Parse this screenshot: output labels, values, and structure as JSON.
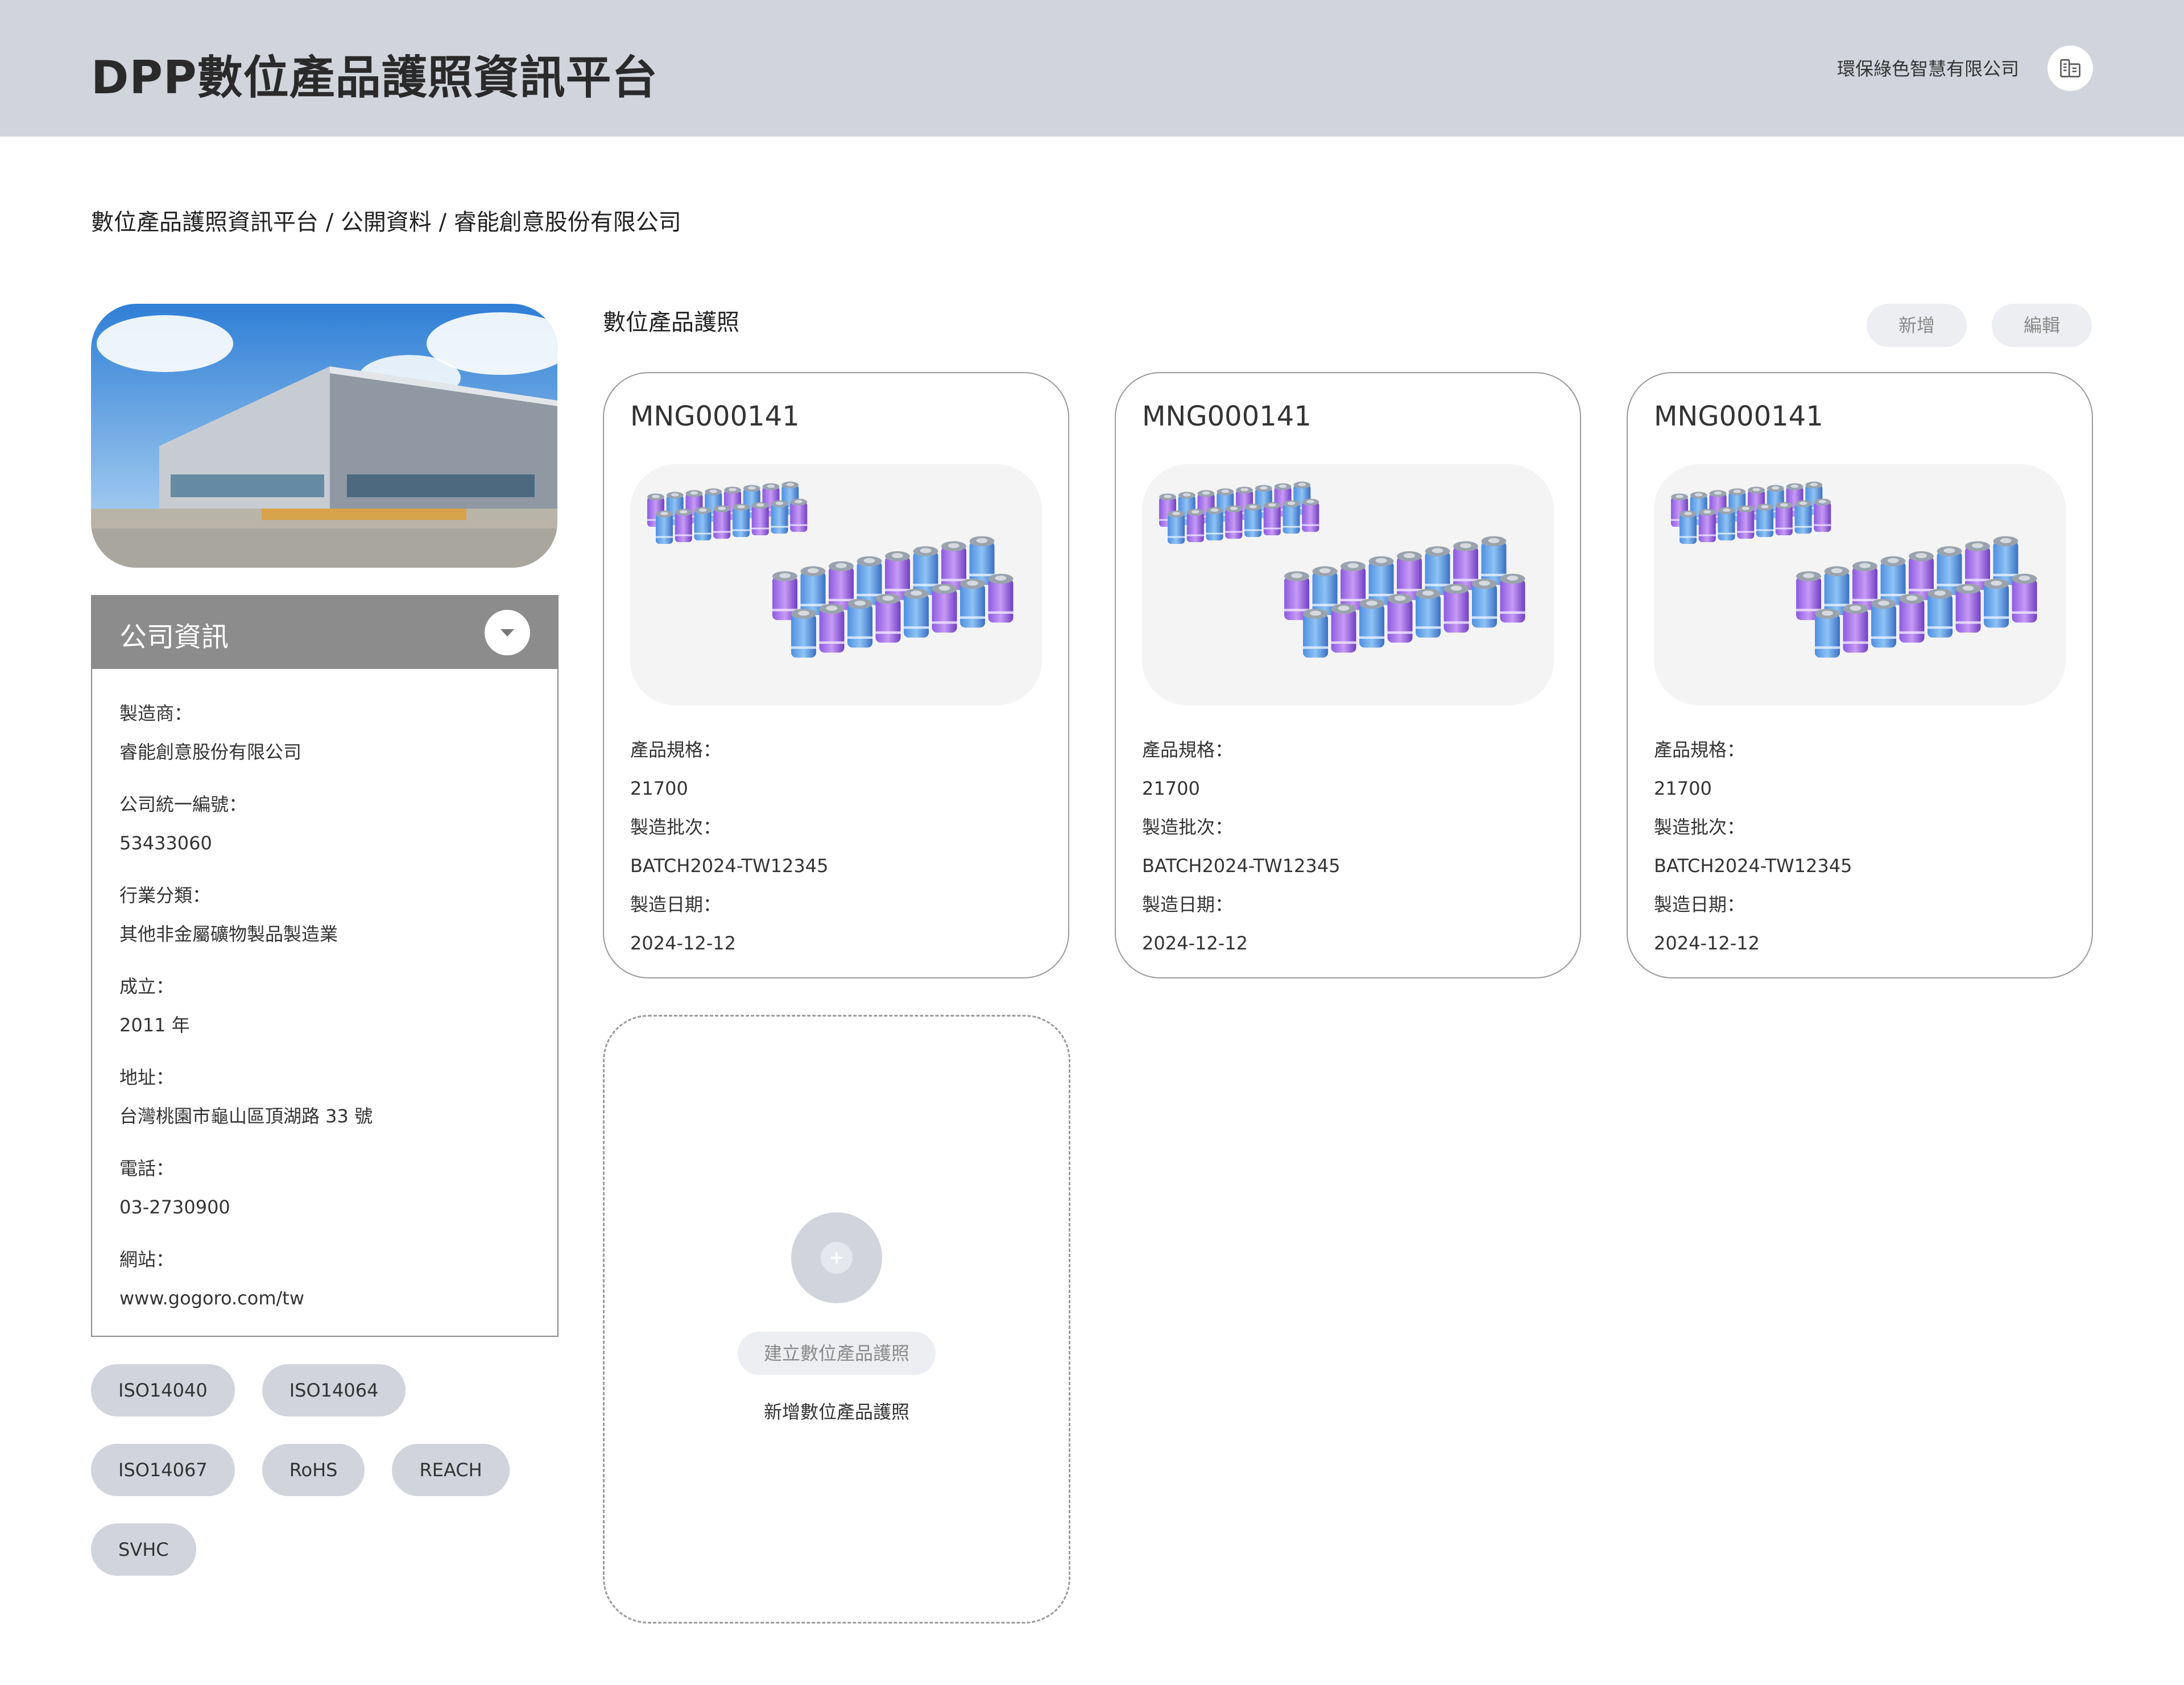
{
  "header": {
    "app_title": "DPP數位產品護照資訊平台",
    "company_name": "環保綠色智慧有限公司",
    "avatar_icon": "building-icon"
  },
  "breadcrumb": "數位產品護照資訊平台 / 公開資料 / 睿能創意股份有限公司",
  "company_info": {
    "title": "公司資訊",
    "fields": [
      {
        "label": "製造商：",
        "value": "睿能創意股份有限公司"
      },
      {
        "label": "公司統一編號：",
        "value": "53433060"
      },
      {
        "label": "行業分類：",
        "value": "其他非金屬礦物製品製造業"
      },
      {
        "label": "成立：",
        "value": "2011 年"
      },
      {
        "label": "地址：",
        "value": "台灣桃園市龜山區頂湖路 33 號"
      },
      {
        "label": "電話：",
        "value": "03-2730900"
      },
      {
        "label": "網站：",
        "value": "www.gogoro.com/tw"
      }
    ]
  },
  "certifications": [
    "ISO14040",
    "ISO14064",
    "ISO14067",
    "RoHS",
    "REACH",
    "SVHC"
  ],
  "passports": {
    "section_title": "數位產品護照",
    "add_label": "新增",
    "edit_label": "編輯",
    "cards": [
      {
        "code": "MNG000141",
        "spec_label": "產品規格：",
        "spec": "21700",
        "batch_label": "製造批次：",
        "batch": "BATCH2024-TW12345",
        "date_label": "製造日期：",
        "date": "2024-12-12"
      },
      {
        "code": "MNG000141",
        "spec_label": "產品規格：",
        "spec": "21700",
        "batch_label": "製造批次：",
        "batch": "BATCH2024-TW12345",
        "date_label": "製造日期：",
        "date": "2024-12-12"
      },
      {
        "code": "MNG000141",
        "spec_label": "產品規格：",
        "spec": "21700",
        "batch_label": "製造批次：",
        "batch": "BATCH2024-TW12345",
        "date_label": "製造日期：",
        "date": "2024-12-12"
      }
    ],
    "create_button": "建立數位產品護照",
    "create_label": "新增數位產品護照"
  }
}
